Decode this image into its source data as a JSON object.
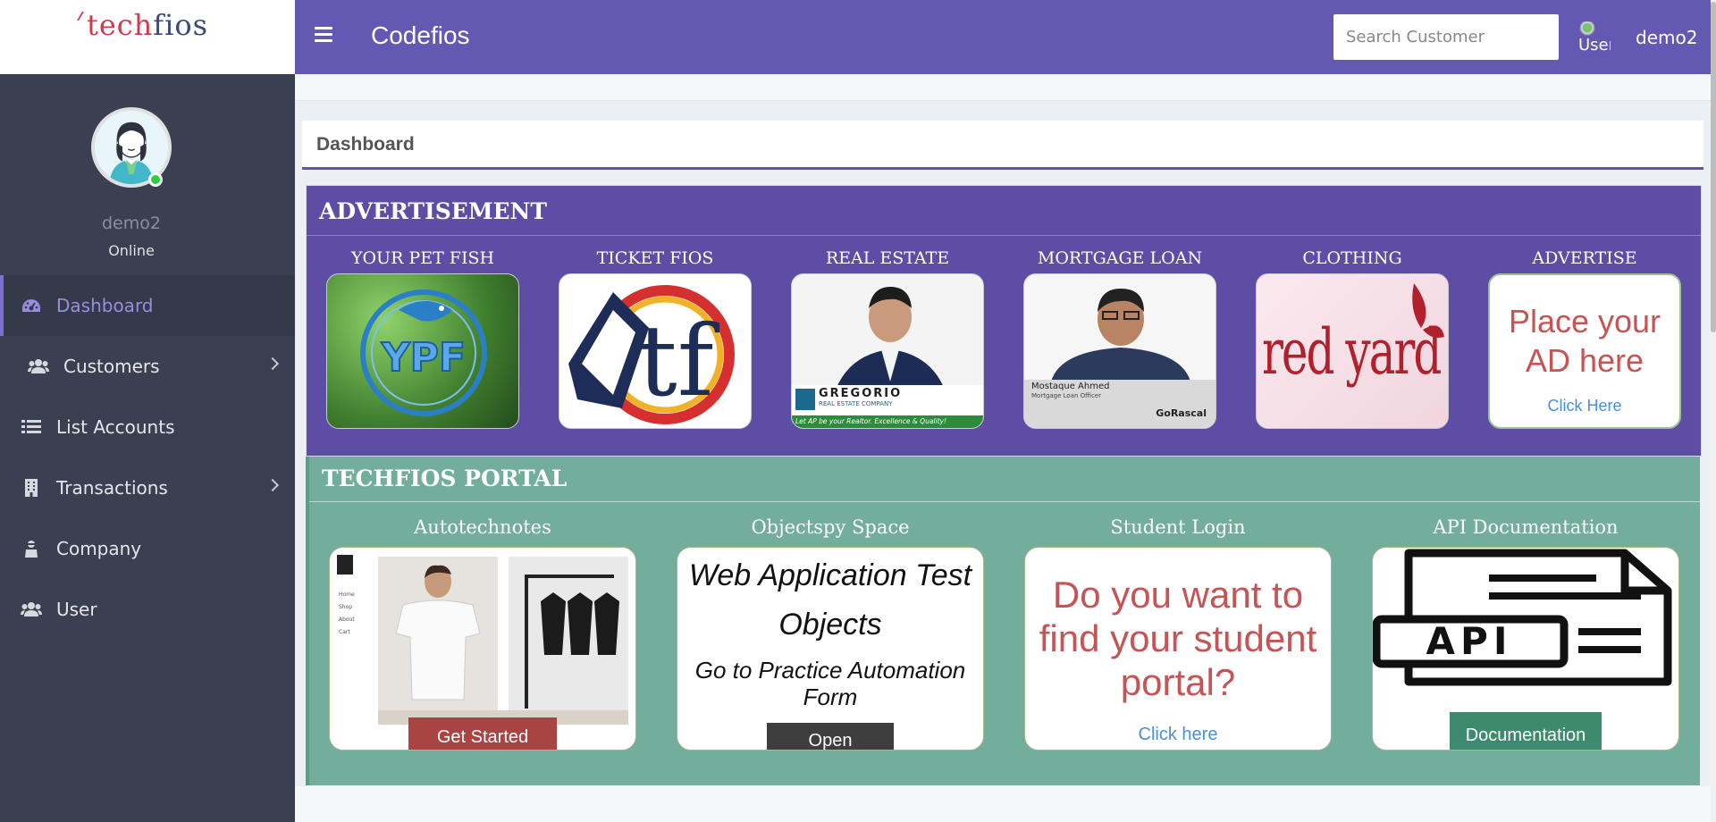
{
  "logo": {
    "part1": "tech",
    "part2": "fios"
  },
  "header": {
    "title": "Codefios",
    "search_placeholder": "Search Customer",
    "avatar_alt": "User",
    "username": "demo2"
  },
  "sidebar": {
    "user": {
      "name": "demo2",
      "status": "Online"
    },
    "items": [
      {
        "label": "Dashboard",
        "icon": "dashboard-icon",
        "active": true
      },
      {
        "label": "Customers",
        "icon": "users-icon",
        "expandable": true
      },
      {
        "label": "List Accounts",
        "icon": "list-icon"
      },
      {
        "label": "Transactions",
        "icon": "building-icon",
        "expandable": true
      },
      {
        "label": "Company",
        "icon": "company-icon"
      },
      {
        "label": "User",
        "icon": "users-icon"
      }
    ]
  },
  "dashboard": {
    "title": "Dashboard"
  },
  "ads": {
    "title": "ADVERTISEMENT",
    "cards": [
      {
        "label": "YOUR PET FISH",
        "logo_text": "YPF"
      },
      {
        "label": "TICKET FIOS",
        "logo_text": "tf"
      },
      {
        "label": "REAL ESTATE",
        "brand": "GREGORIO",
        "brand_sub": "REAL ESTATE COMPANY",
        "tagline": "Let AP be your Realtor. Excellence & Quality!"
      },
      {
        "label": "MORTGAGE LOAN",
        "name": "Mostaque Ahmed",
        "role": "Mortgage Loan Officer",
        "brand": "GoRascal"
      },
      {
        "label": "CLOTHING",
        "logo_text": "red yard"
      },
      {
        "label": "ADVERTISE",
        "line1": "Place your",
        "line2": "AD here",
        "link": "Click Here"
      }
    ]
  },
  "portal": {
    "title": "TECHFIOS PORTAL",
    "cards": [
      {
        "label": "Autotechnotes",
        "button": "Get Started",
        "menu": [
          "Home",
          "Shop",
          "About",
          "Cart"
        ]
      },
      {
        "label": "Objectspy Space",
        "line1": "Web Application Test",
        "line2": "Objects",
        "line3": "Go to Practice Automation",
        "line4": "Form",
        "button": "Open"
      },
      {
        "label": "Student Login",
        "line1": "Do you want to",
        "line2": "find your student",
        "line3": "portal?",
        "link": "Click here"
      },
      {
        "label": "API Documentation",
        "api_text": "API",
        "button": "Documentation"
      }
    ]
  },
  "colors": {
    "header": "#6359b3",
    "sidebar": "#3a3f51",
    "ad_panel": "#5e4da5",
    "portal_panel": "#72ae9b",
    "accent": "#7b6fd1",
    "btn_red": "#a94442",
    "btn_dark": "#3e3e3e",
    "btn_green": "#3e8a6e"
  }
}
